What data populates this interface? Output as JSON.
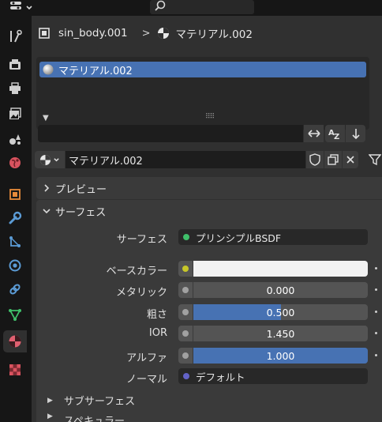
{
  "header": {
    "editor_menu_icon": "properties-editor-icon",
    "search_icon": "search-icon"
  },
  "tabs": [
    {
      "name": "tool",
      "icon": "wrench-screwdriver-icon",
      "color": "#c8c8c8"
    },
    {
      "name": "render",
      "icon": "camera-back-icon",
      "color": "#c8c8c8"
    },
    {
      "name": "output",
      "icon": "printer-icon",
      "color": "#c8c8c8"
    },
    {
      "name": "view-layer",
      "icon": "images-icon",
      "color": "#c8c8c8"
    },
    {
      "name": "scene",
      "icon": "scene-icon",
      "color": "#c8c8c8"
    },
    {
      "name": "world",
      "icon": "world-icon",
      "color": "#d9535f"
    },
    {
      "name": "object",
      "icon": "object-square-icon",
      "color": "#e88b3a"
    },
    {
      "name": "modifiers",
      "icon": "wrench-icon",
      "color": "#5b9bd5"
    },
    {
      "name": "particles",
      "icon": "particles-icon",
      "color": "#5b9bd5"
    },
    {
      "name": "physics",
      "icon": "physics-icon",
      "color": "#5b9bd5"
    },
    {
      "name": "constraints",
      "icon": "constraint-icon",
      "color": "#5b9bd5"
    },
    {
      "name": "data",
      "icon": "mesh-triangle-icon",
      "color": "#3fbf6a"
    },
    {
      "name": "material",
      "icon": "material-sphere-icon",
      "color": "#e06070",
      "active": true
    },
    {
      "name": "texture",
      "icon": "checker-texture-icon",
      "color": "#d9535f"
    }
  ],
  "breadcrumb": {
    "object": "sin_body.001",
    "separator": ">",
    "material": "マテリアル.002"
  },
  "slots": {
    "items": [
      "マテリアル.002"
    ],
    "filter_value": ""
  },
  "material_datablock": {
    "name": "マテリアル.002"
  },
  "sections": {
    "preview": "プレビュー",
    "surface": "サーフェス",
    "subsurface": "サブサーフェス",
    "specular": "スペキュラー"
  },
  "surface": {
    "shader_label": "サーフェス",
    "shader_value": "プリンシプルBSDF",
    "shader_socket_color": "#3fbf6a",
    "base_color_label": "ベースカラー",
    "base_color_value": "#f2f2f2",
    "base_color_socket": "#c7c729",
    "metallic_label": "メタリック",
    "metallic_value": "0.000",
    "metallic_fraction": 0.0,
    "roughness_label": "粗さ",
    "roughness_value": "0.500",
    "roughness_fraction": 0.5,
    "ior_label": "IOR",
    "ior_value": "1.450",
    "ior_fraction": 0.0,
    "alpha_label": "アルファ",
    "alpha_value": "1.000",
    "alpha_fraction": 1.0,
    "float_socket_color": "#a1a1a1",
    "normal_label": "ノーマル",
    "normal_value": "デフォルト",
    "normal_socket_color": "#6363c7"
  },
  "colors": {
    "accent": "#4772b3",
    "panel": "#303030",
    "section": "#3a3a3a",
    "field": "#545454"
  }
}
